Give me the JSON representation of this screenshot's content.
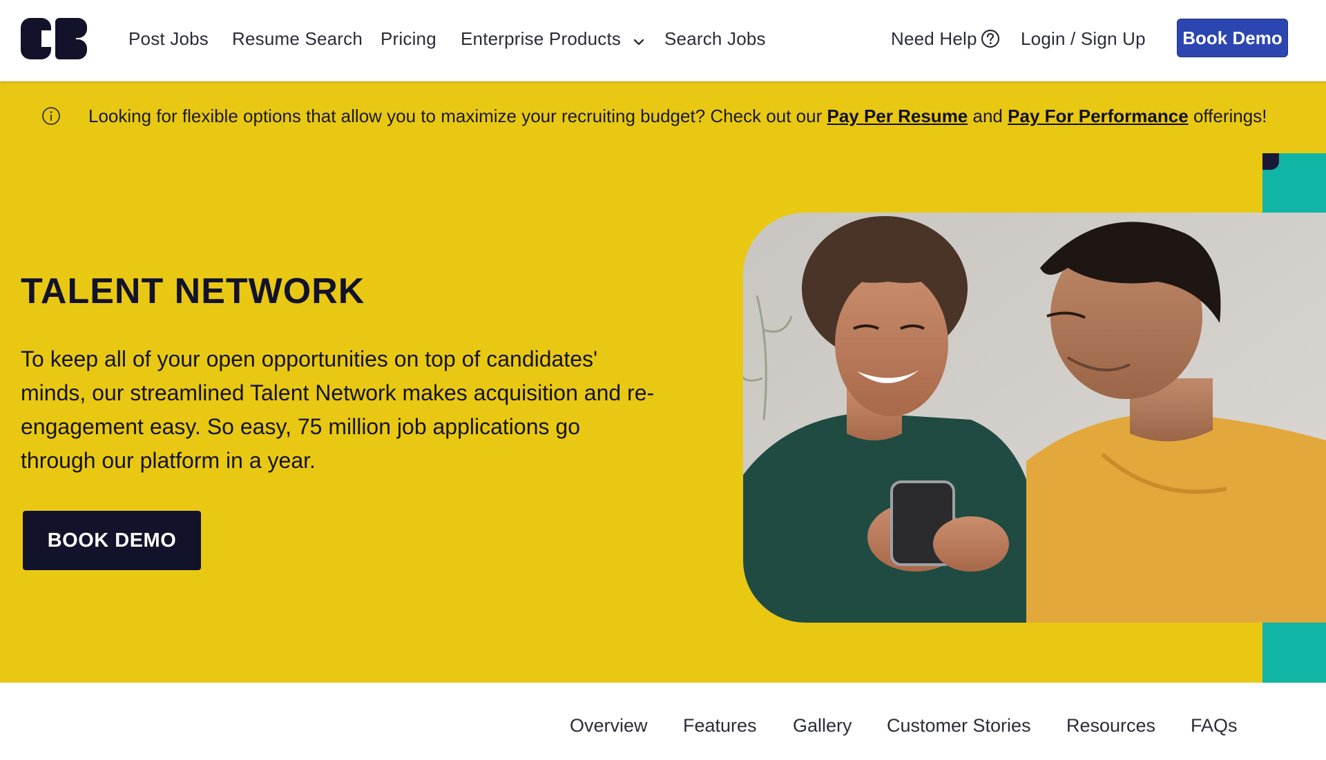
{
  "header": {
    "logo_alt": "CB",
    "nav": [
      {
        "label": "Post Jobs"
      },
      {
        "label": "Resume Search"
      },
      {
        "label": "Pricing"
      },
      {
        "label": "Enterprise Products"
      },
      {
        "label": "Search Jobs"
      }
    ],
    "need_help": "Need Help",
    "login": "Login / Sign Up",
    "book_demo": "Book Demo"
  },
  "banner": {
    "text_before": "Looking for flexible options that allow you to maximize your recruiting budget? Check out our",
    "link1": "Pay Per Resume",
    "text_mid": "and",
    "link2": "Pay For Performance",
    "text_after": "offerings!"
  },
  "hero": {
    "title": "TALENT NETWORK",
    "body": "To keep all of your open opportunities on top of candidates' minds, our streamlined Talent Network makes acquisition and re-engagement easy. So easy, 75 million job applications go through our platform in a year.",
    "button": "BOOK DEMO"
  },
  "section_tabs": [
    {
      "label": "Overview"
    },
    {
      "label": "Features"
    },
    {
      "label": "Gallery"
    },
    {
      "label": "Customer Stories"
    },
    {
      "label": "Resources"
    },
    {
      "label": "FAQs"
    }
  ],
  "colors": {
    "brand_yellow": "#e9c813",
    "brand_navy": "#12122a",
    "button_blue": "#2c46b1",
    "accent_teal": "#11b5a5"
  },
  "icons": {
    "dropdown": "chevron-down-icon",
    "help": "question-circle-icon",
    "info": "info-circle-icon"
  }
}
